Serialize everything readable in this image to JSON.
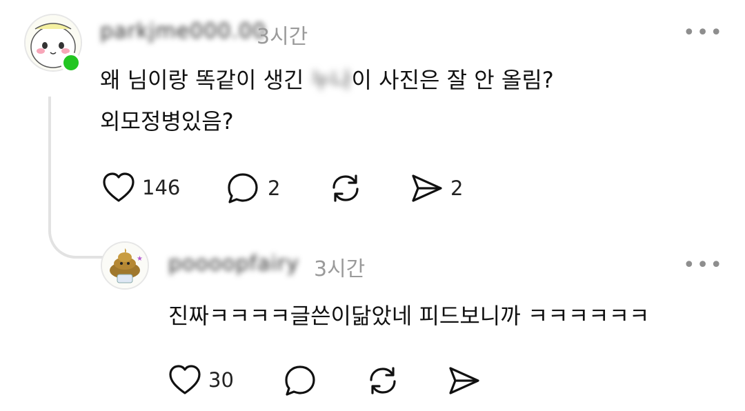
{
  "post": {
    "username": "parkjme000.00",
    "time": "3시간",
    "more_label": "•••",
    "text_line1_before": "왜 님이랑 똑같이 생긴",
    "text_line1_blurred": "누나",
    "text_line1_after": "이 사진은 잘 안 올림?",
    "text_line2": "외모정병있음?",
    "likes": "146",
    "comments": "2",
    "shares": "2"
  },
  "reply": {
    "username": "poooopfairy",
    "time": "3시간",
    "more_label": "•••",
    "text": "진짜ㅋㅋㅋㅋ글쓴이닮았네 피드보니까 ㅋㅋㅋㅋㅋㅋ",
    "likes": "30"
  },
  "icons": {
    "like": "heart-icon",
    "comment": "comment-icon",
    "repost": "repost-icon",
    "share": "send-icon"
  },
  "colors": {
    "online": "#22c521",
    "muted": "#9a9a9a",
    "text": "#111111"
  }
}
